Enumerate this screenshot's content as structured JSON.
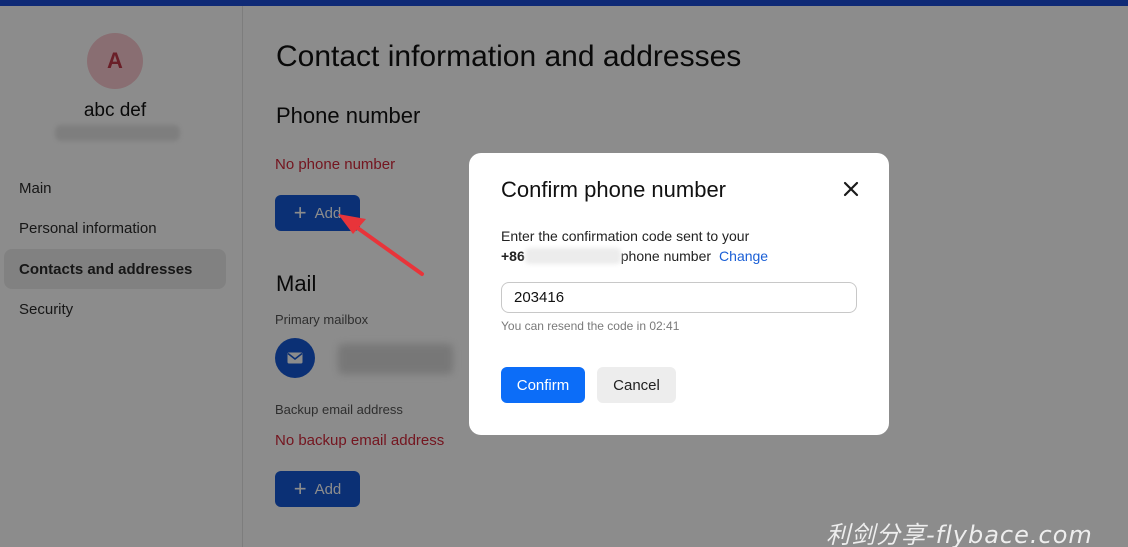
{
  "user": {
    "avatar_letter": "A",
    "name": "abc def"
  },
  "sidebar": {
    "items": [
      {
        "label": "Main"
      },
      {
        "label": "Personal information"
      },
      {
        "label": "Contacts and addresses"
      },
      {
        "label": "Security"
      }
    ]
  },
  "main": {
    "title": "Contact information and addresses",
    "phone": {
      "heading": "Phone number",
      "status": "No phone number",
      "add_label": "Add"
    },
    "mail": {
      "heading": "Mail",
      "primary_label": "Primary mailbox",
      "backup_label": "Backup email address",
      "backup_status": "No backup email address",
      "add_label": "Add"
    }
  },
  "dialog": {
    "title": "Confirm phone number",
    "text_line1": "Enter the confirmation code sent to your",
    "phone_prefix": "+86",
    "text_line2_suffix": "phone number",
    "change_label": "Change",
    "code_value": "203416",
    "resend_text": "You can resend the code in 02:41",
    "confirm_label": "Confirm",
    "cancel_label": "Cancel"
  },
  "watermark": "利剑分享-flybace.com",
  "colors": {
    "accent": "#1558d6",
    "confirm": "#0c6df8",
    "warning": "#d3283b",
    "annotation_arrow": "#e8343a"
  }
}
